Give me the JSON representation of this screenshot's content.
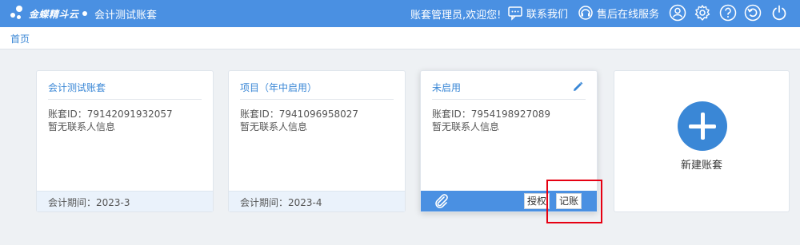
{
  "brand": {
    "logo_text": "金蝶精斗云"
  },
  "header": {
    "book_name": "会计测试账套",
    "greeting": "账套管理员,欢迎您!",
    "contact_label": "联系我们",
    "service_label": "售后在线服务"
  },
  "breadcrumb": {
    "home": "首页"
  },
  "cards": [
    {
      "title": "会计测试账套",
      "id_text": "账套ID：79142091932057",
      "contact_text": "暂无联系人信息",
      "period_text": "会计期间：2023-3"
    },
    {
      "title": "项目（年中启用）",
      "id_text": "账套ID：7941096958027",
      "contact_text": "暂无联系人信息",
      "period_text": "会计期间：2023-4"
    },
    {
      "title": "未启用",
      "id_text": "账套ID：7954198927089",
      "contact_text": "暂无联系人信息",
      "authorize_label": "授权",
      "bookkeep_label": "记账"
    }
  ],
  "new_card": {
    "label": "新建账套"
  },
  "icons": [
    "logo-icon",
    "chat-icon",
    "headset-icon",
    "user-icon",
    "gear-icon",
    "help-icon",
    "refresh-icon",
    "power-icon",
    "edit-icon",
    "paperclip-icon",
    "plus-icon"
  ],
  "colors": {
    "primary": "#4a90e2",
    "link": "#3a87d6",
    "highlight": "#e60012"
  }
}
